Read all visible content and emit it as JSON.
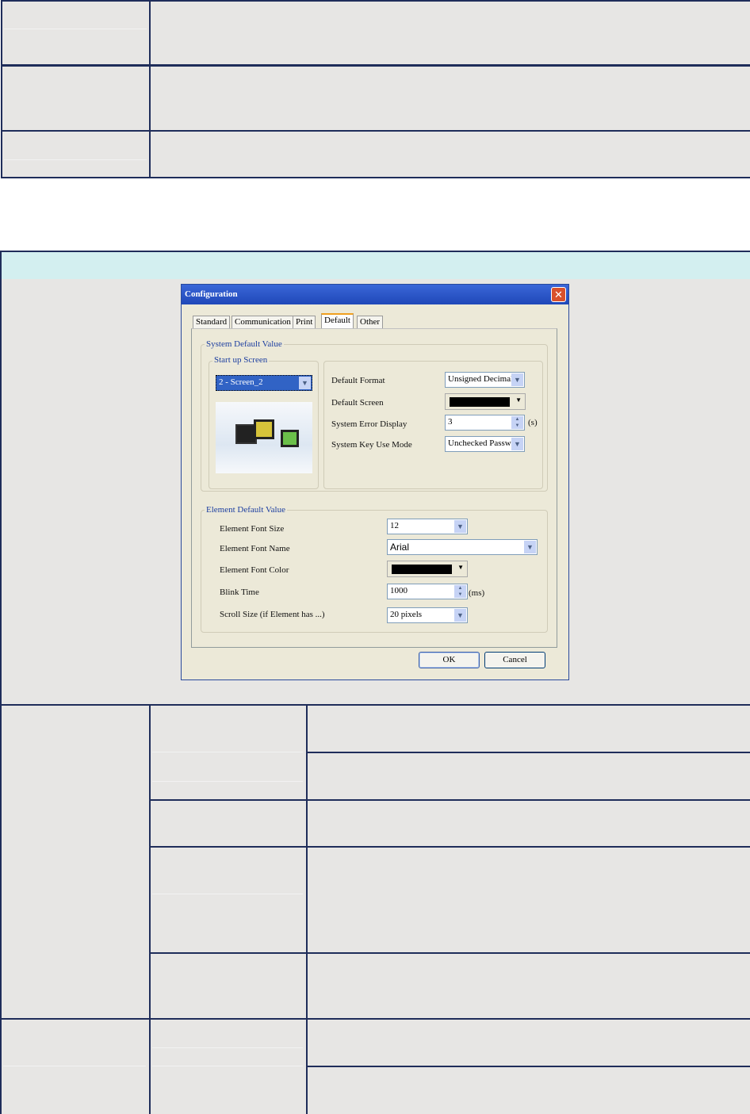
{
  "dialog": {
    "title": "Configuration",
    "tabs": [
      "Standard",
      "Communication",
      "Print",
      "Default",
      "Other"
    ],
    "active_tab": "Default",
    "system_group": "System Default Value",
    "startup_group": "Start up Screen",
    "startup_value": "2 - Screen_2",
    "fields": {
      "default_format": {
        "label": "Default Format",
        "value": "Unsigned Decimal"
      },
      "default_screen": {
        "label": "Default Screen",
        "color": "#000000"
      },
      "system_error_display": {
        "label": "System Error Display",
        "value": "3",
        "unit": "(s)"
      },
      "system_key_use_mode": {
        "label": "System Key Use Mode",
        "value": "Unchecked Passwo"
      }
    },
    "element_group": "Element Default Value",
    "element_fields": {
      "font_size": {
        "label": "Element Font Size",
        "value": "12"
      },
      "font_name": {
        "label": "Element Font Name",
        "value": "Arial"
      },
      "font_color": {
        "label": "Element Font Color",
        "color": "#000000"
      },
      "blink_time": {
        "label": "Blink Time",
        "value": "1000",
        "unit": "(ms)"
      },
      "scroll_size": {
        "label": "Scroll Size (if Element has ...)",
        "value": "20 pixels"
      }
    },
    "ok": "OK",
    "cancel": "Cancel"
  }
}
